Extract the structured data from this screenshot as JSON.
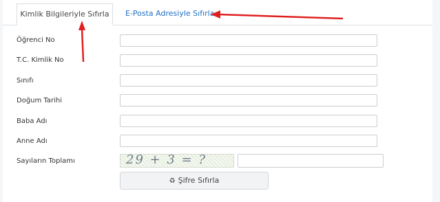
{
  "tabs": [
    {
      "label": "Kimlik Bilgileriyle Sıfırla",
      "active": true
    },
    {
      "label": "E-Posta Adresiyle Sıfırla",
      "active": false
    }
  ],
  "form": {
    "fields": [
      {
        "label": "Öğrenci No",
        "value": ""
      },
      {
        "label": "T.C. Kimlik No",
        "value": ""
      },
      {
        "label": "Sınıfı",
        "value": ""
      },
      {
        "label": "Doğum Tarihi",
        "value": ""
      },
      {
        "label": "Baba Adı",
        "value": ""
      },
      {
        "label": "Anne Adı",
        "value": ""
      }
    ],
    "captcha_label": "Sayıların Toplamı",
    "captcha_text": "29 + 3 = ?",
    "captcha_value": ""
  },
  "reset_button": {
    "label": "Şifre Sıfırla",
    "icon": "recycle-icon"
  },
  "colors": {
    "link": "#1f6fc5",
    "annotation_arrow": "#e02020"
  }
}
